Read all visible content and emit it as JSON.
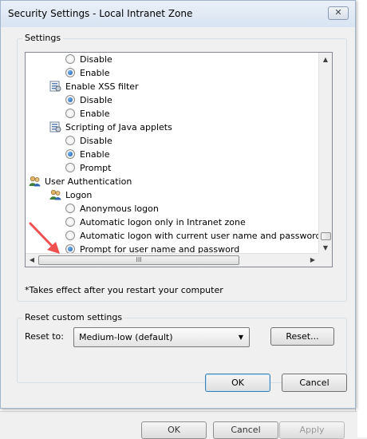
{
  "window": {
    "title": "Security Settings - Local Intranet Zone",
    "close_glyph": "✕"
  },
  "settings_group": {
    "label": "Settings"
  },
  "settings_list": [
    {
      "kind": "radio",
      "label": "Disable",
      "checked": false
    },
    {
      "kind": "radio",
      "label": "Enable",
      "checked": true
    },
    {
      "kind": "header",
      "label": "Enable XSS filter"
    },
    {
      "kind": "radio",
      "label": "Disable",
      "checked": true
    },
    {
      "kind": "radio",
      "label": "Enable",
      "checked": false
    },
    {
      "kind": "header",
      "label": "Scripting of Java applets"
    },
    {
      "kind": "radio",
      "label": "Disable",
      "checked": false
    },
    {
      "kind": "radio",
      "label": "Enable",
      "checked": true
    },
    {
      "kind": "radio",
      "label": "Prompt",
      "checked": false
    },
    {
      "kind": "category",
      "label": "User Authentication"
    },
    {
      "kind": "subcategory",
      "label": "Logon"
    },
    {
      "kind": "radio",
      "label": "Anonymous logon",
      "checked": false
    },
    {
      "kind": "radio",
      "label": "Automatic logon only in Intranet zone",
      "checked": false
    },
    {
      "kind": "radio",
      "label": "Automatic logon with current user name and password",
      "checked": false
    },
    {
      "kind": "radio",
      "label": "Prompt for user name and password",
      "checked": true
    }
  ],
  "scrollbar": {
    "h_thumb_glyph": "III",
    "up": "▲",
    "down": "▼",
    "left": "◀",
    "right": "▶"
  },
  "note": "*Takes effect after you restart your computer",
  "reset_group": {
    "label": "Reset custom settings",
    "reset_to_label": "Reset to:",
    "selected": "Medium-low (default)",
    "caret": "▼",
    "reset_button": "Reset..."
  },
  "buttons": {
    "ok": "OK",
    "cancel": "Cancel"
  },
  "background_buttons": {
    "ok": "OK",
    "cancel": "Cancel",
    "apply": "Apply"
  },
  "colors": {
    "arrow": "#f0504f",
    "radio_selected": "#1c5aa6"
  }
}
